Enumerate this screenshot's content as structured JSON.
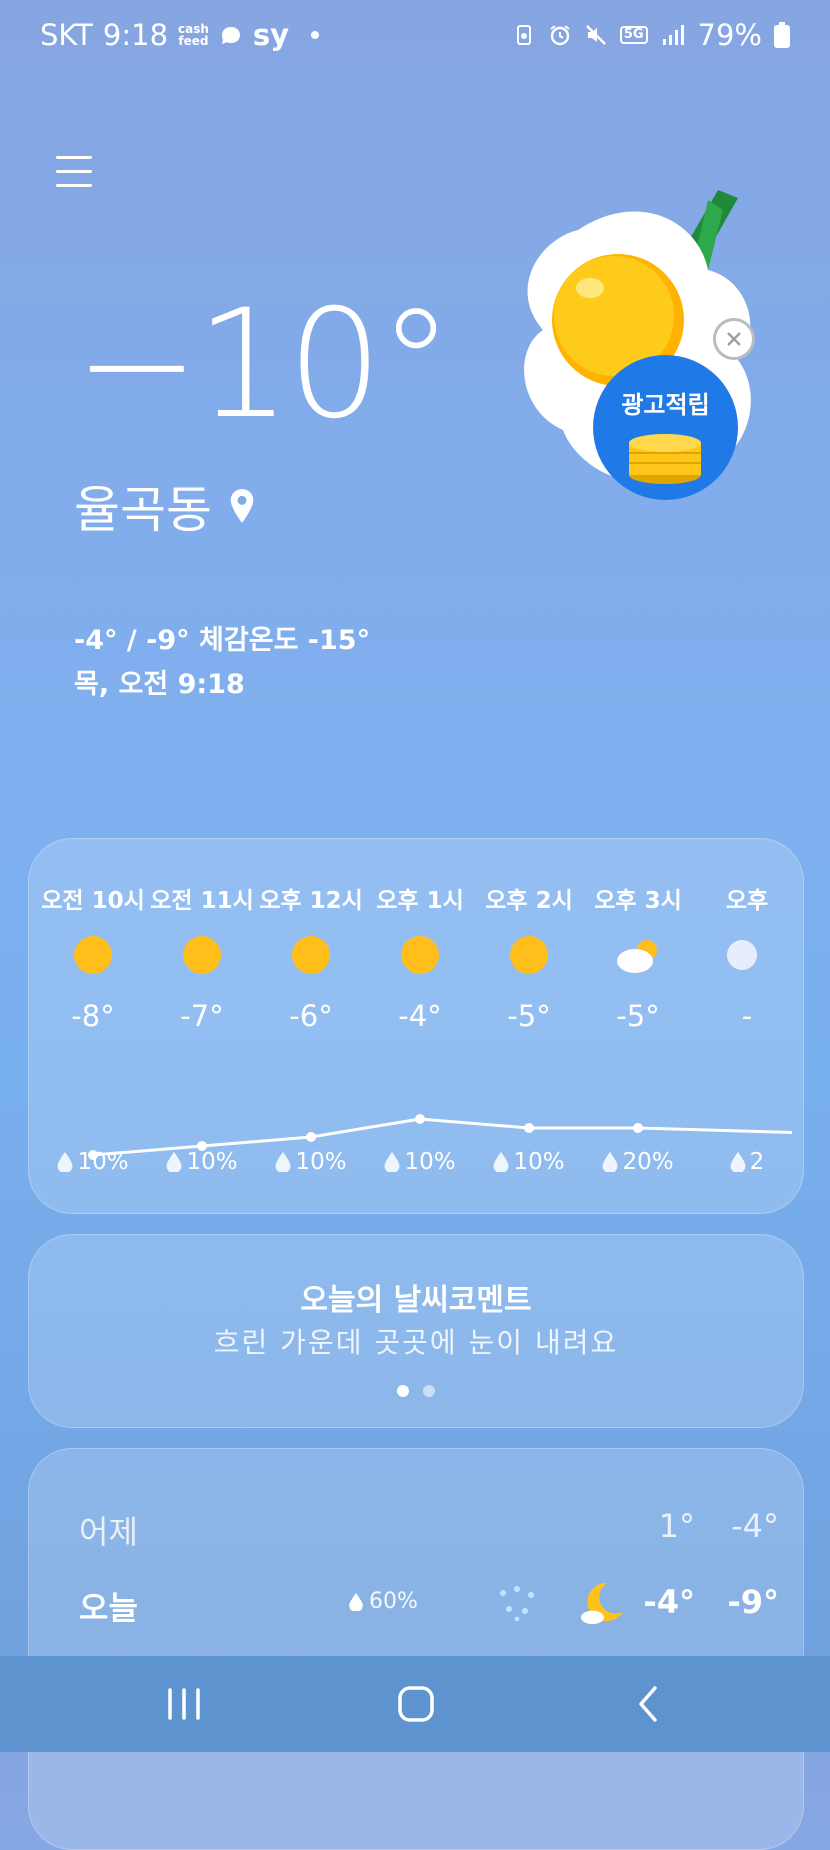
{
  "status_bar": {
    "carrier": "SKT",
    "time": "9:18",
    "cashfeed_top": "cash",
    "cashfeed_bottom": "feed",
    "sy": "sy",
    "battery": "79%",
    "network": "5G"
  },
  "current": {
    "temp": "−10°",
    "location": "율곡동",
    "hi_lo_feels": "-4° / -9° 체감온도 -15°",
    "datetime": "목, 오전 9:18"
  },
  "ad": {
    "label": "광고적립"
  },
  "hourly": [
    {
      "time": "오전 10시",
      "icon": "sun-icon",
      "temp": "-8°",
      "temp_value": -8,
      "precip": "10%"
    },
    {
      "time": "오전 11시",
      "icon": "sun-icon",
      "temp": "-7°",
      "temp_value": -7,
      "precip": "10%"
    },
    {
      "time": "오후 12시",
      "icon": "sun-icon",
      "temp": "-6°",
      "temp_value": -6,
      "precip": "10%"
    },
    {
      "time": "오후 1시",
      "icon": "sun-icon",
      "temp": "-4°",
      "temp_value": -4,
      "precip": "10%"
    },
    {
      "time": "오후 2시",
      "icon": "sun-icon",
      "temp": "-5°",
      "temp_value": -5,
      "precip": "10%"
    },
    {
      "time": "오후 3시",
      "icon": "partly-cloudy-icon",
      "temp": "-5°",
      "temp_value": -5,
      "precip": "20%"
    },
    {
      "time": "오후",
      "icon": "moon-icon",
      "temp": "-",
      "temp_value": -5.5,
      "precip": "2"
    }
  ],
  "comment": {
    "title": "오늘의 날씨코멘트",
    "text": "흐린 가운데 곳곳에 눈이 내려요"
  },
  "daily": [
    {
      "day": "어제",
      "hi": "1°",
      "lo": "-4°"
    },
    {
      "day": "오늘",
      "precip": "60%",
      "hi": "-4°",
      "lo": "-9°"
    }
  ],
  "colors": {
    "sun": "#ffbe1a",
    "bg_top": "#86a6e2",
    "nav_bar": "#5d94cf"
  }
}
